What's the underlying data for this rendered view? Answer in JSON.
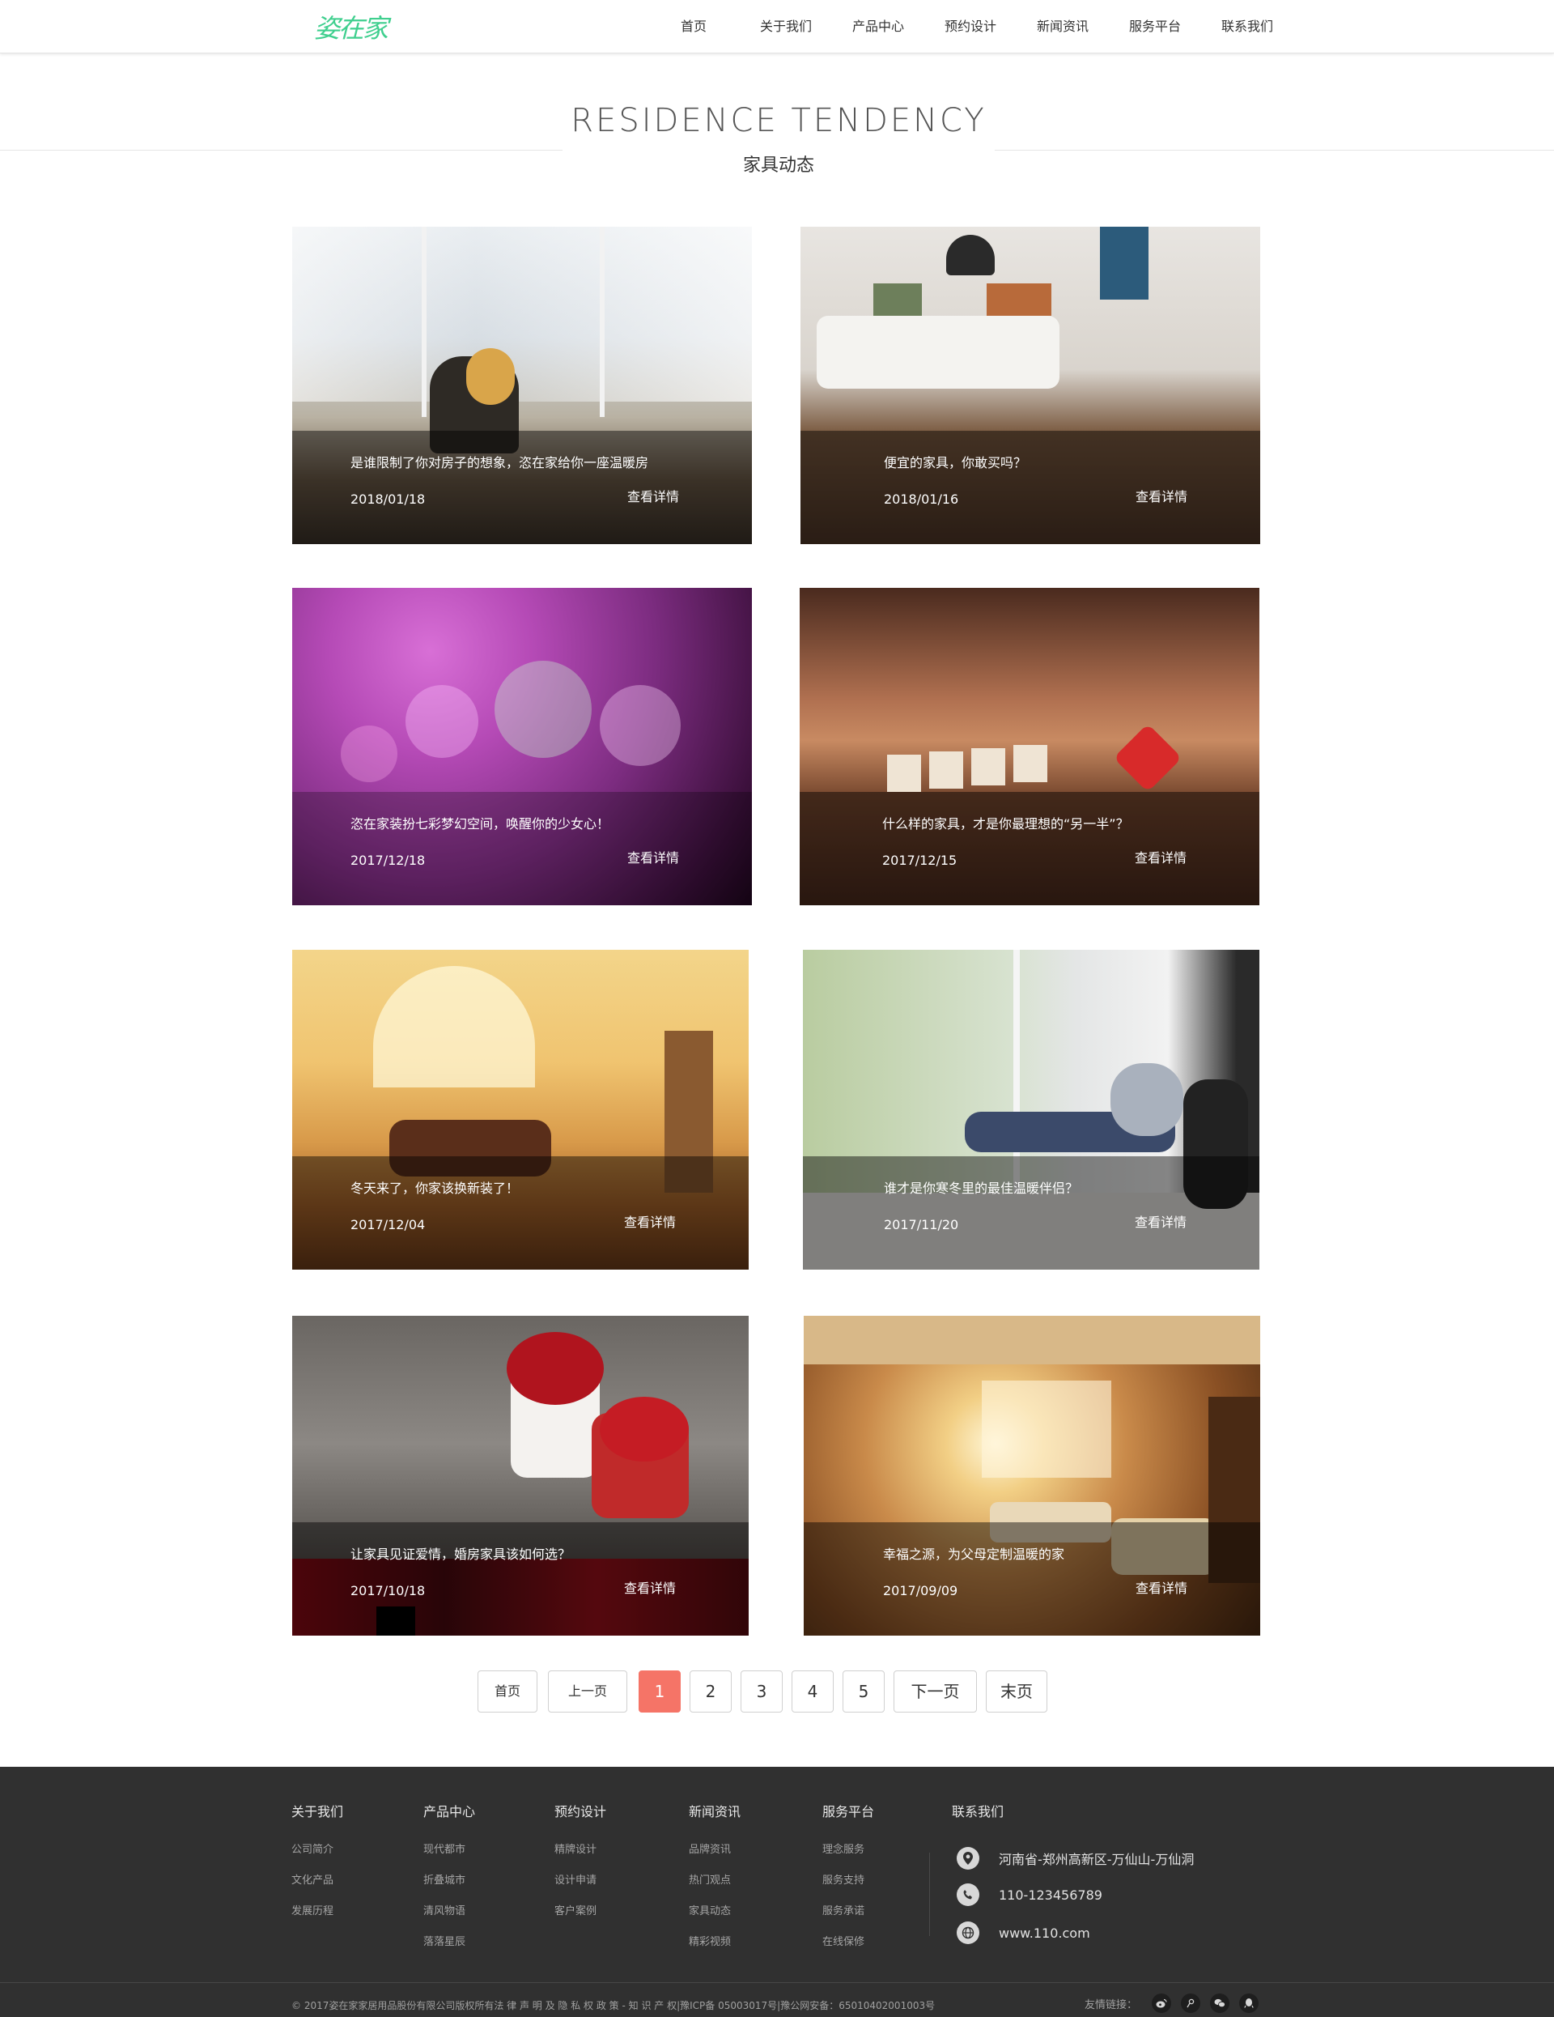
{
  "header": {
    "logo": "姿在家",
    "nav": [
      "首页",
      "关于我们",
      "产品中心",
      "预约设计",
      "新闻资讯",
      "服务平台",
      "联系我们"
    ]
  },
  "section": {
    "title_en": "RESIDENCE TENDENCY",
    "title_cn": "家具动态"
  },
  "cards": [
    {
      "title": "是谁限制了你对房子的想象，恣在家给你一座温暖房",
      "date": "2018/01/18",
      "more": "查看详情",
      "scene": "snowy-living-room"
    },
    {
      "title": "便宜的家具，你敢买吗？",
      "date": "2018/01/16",
      "more": "查看详情",
      "scene": "white-sofa-room"
    },
    {
      "title": "恣在家装扮七彩梦幻空间，唤醒你的少女心！",
      "date": "2017/12/18",
      "more": "查看详情",
      "scene": "purple-bokeh"
    },
    {
      "title": "什么样的家具，才是你最理想的“另一半”？",
      "date": "2017/12/15",
      "more": "查看详情",
      "scene": "love-blocks"
    },
    {
      "title": "冬天来了，你家该换新装了！",
      "date": "2017/12/04",
      "more": "查看详情",
      "scene": "sunlit-living-room"
    },
    {
      "title": "谁才是你寒冬里的最佳温暖伴侣？",
      "date": "2017/11/20",
      "more": "查看详情",
      "scene": "mother-daughter-window"
    },
    {
      "title": "让家具见证爱情，婚房家具该如何选？",
      "date": "2017/10/18",
      "more": "查看详情",
      "scene": "roses-cups"
    },
    {
      "title": "幸福之源，为父母定制温暖的家",
      "date": "2017/09/09",
      "more": "查看详情",
      "scene": "warm-family-room"
    }
  ],
  "pagination": {
    "first": "首页",
    "prev": "上一页",
    "pages": [
      "1",
      "2",
      "3",
      "4",
      "5"
    ],
    "current": "1",
    "next": "下一页",
    "last": "末页"
  },
  "footer": {
    "columns": [
      {
        "head": "关于我们",
        "links": [
          "公司简介",
          "文化产品",
          "发展历程"
        ]
      },
      {
        "head": "产品中心",
        "links": [
          "现代都市",
          "折叠城市",
          "清风物语",
          "落落星辰"
        ]
      },
      {
        "head": "预约设计",
        "links": [
          "精牌设计",
          "设计申请",
          "客户案例"
        ]
      },
      {
        "head": "新闻资讯",
        "links": [
          "品牌资讯",
          "热门观点",
          "家具动态",
          "精彩视频"
        ]
      },
      {
        "head": "服务平台",
        "links": [
          "理念服务",
          "服务支持",
          "服务承诺",
          "在线保修"
        ]
      }
    ],
    "contact": {
      "head": "联系我们",
      "address": "河南省-郑州高新区-万仙山-万仙洞",
      "phone": "110-123456789",
      "website": "www.110.com"
    },
    "copyright": "© 2017姿在家家居用品股份有限公司版权所有法 律 声 明 及 隐 私 权 政 策 - 知 识 产 权|豫ICP备 05003017号|豫公网安备：65010402001003号",
    "friend_label": "友情链接：",
    "social_icons": [
      "weibo-icon",
      "tencent-weibo-icon",
      "wechat-icon",
      "qq-icon"
    ]
  }
}
